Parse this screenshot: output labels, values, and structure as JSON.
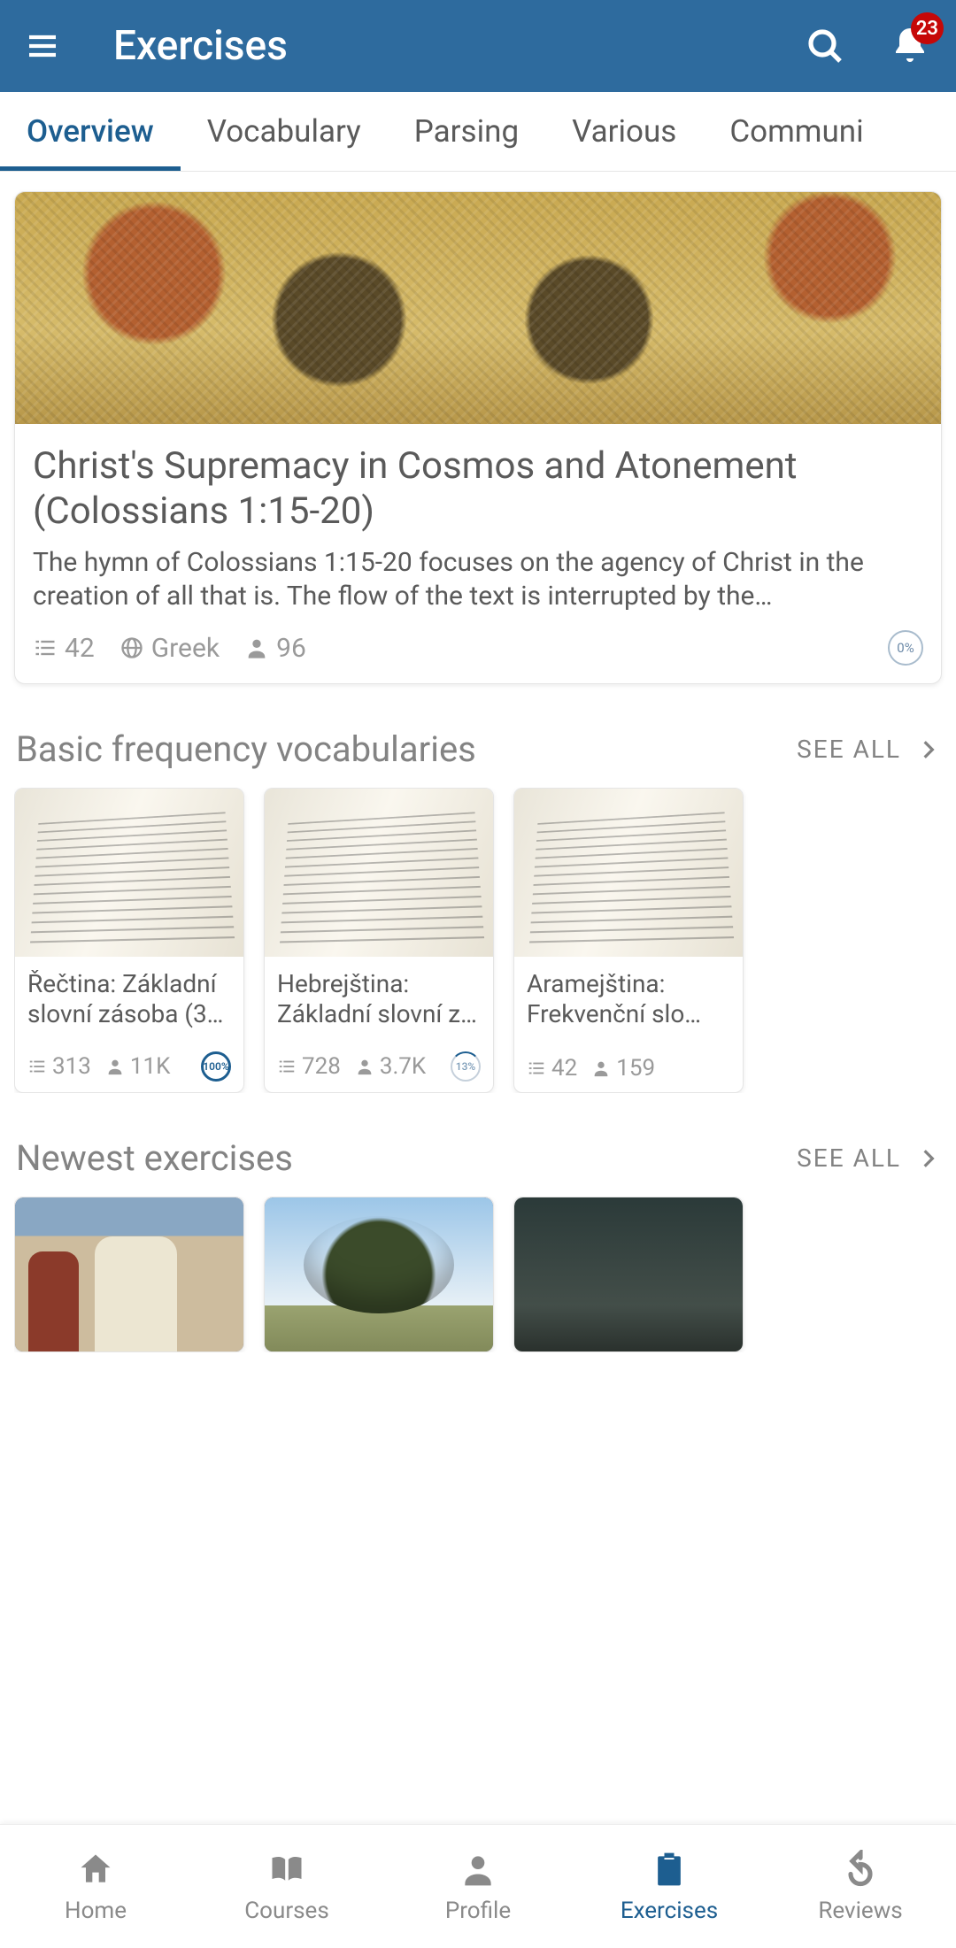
{
  "header": {
    "title": "Exercises",
    "badge_count": "23"
  },
  "tabs": [
    {
      "label": "Overview",
      "active": true
    },
    {
      "label": "Vocabulary"
    },
    {
      "label": "Parsing"
    },
    {
      "label": "Various"
    },
    {
      "label": "Communi"
    }
  ],
  "featured": {
    "title": "Christ's Supremacy in Cosmos and Atonement  (Colossians 1:15-20)",
    "description": "The hymn of Colossians 1:15-20 focuses on the agency of Christ in the creation of all that is. The flow of the text is interrupted by the…",
    "items": "42",
    "language": "Greek",
    "users": "96",
    "progress": "0%"
  },
  "sections": {
    "vocab": {
      "title": "Basic frequency vocabularies",
      "see_all": "SEE ALL",
      "cards": [
        {
          "title": "Řečtina: Základní slovní zásoba (3…",
          "items": "313",
          "users": "11K",
          "progress": "100%"
        },
        {
          "title": "Hebrejština: Základní slovní z…",
          "items": "728",
          "users": "3.7K",
          "progress": "13%"
        },
        {
          "title": "Aramejština: Frekvenční slo…",
          "items": "42",
          "users": "159",
          "progress": ""
        }
      ]
    },
    "newest": {
      "title": "Newest exercises",
      "see_all": "SEE ALL"
    }
  },
  "bottom_nav": [
    {
      "id": "home",
      "label": "Home"
    },
    {
      "id": "courses",
      "label": "Courses"
    },
    {
      "id": "profile",
      "label": "Profile"
    },
    {
      "id": "exercises",
      "label": "Exercises",
      "active": true
    },
    {
      "id": "reviews",
      "label": "Reviews"
    }
  ]
}
